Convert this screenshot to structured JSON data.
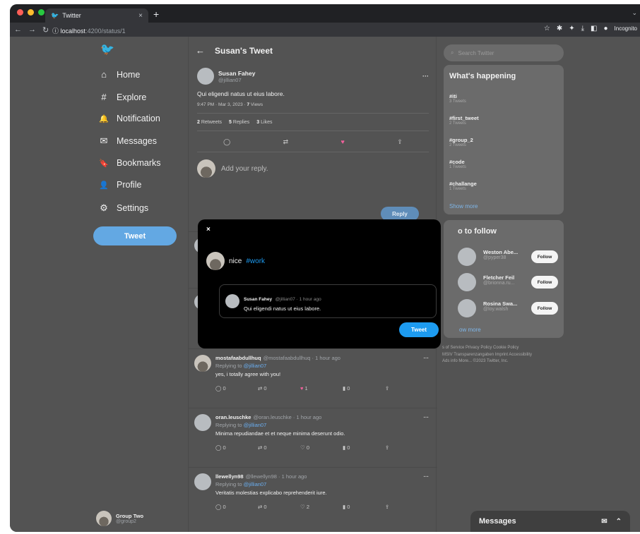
{
  "browser": {
    "tab_title": "Twitter",
    "tab_close": "×",
    "new_tab": "+",
    "url_host": "localhost",
    "url_path": ":4200/status/1",
    "incognito_label": "Incognito"
  },
  "sidebar": {
    "items": [
      {
        "label": "Home",
        "icon": "home-icon",
        "glyph": "⌂"
      },
      {
        "label": "Explore",
        "icon": "hashtag-icon",
        "glyph": "#"
      },
      {
        "label": "Notification",
        "icon": "bell-icon",
        "glyph": "🔔"
      },
      {
        "label": "Messages",
        "icon": "envelope-icon",
        "glyph": "✉"
      },
      {
        "label": "Bookmarks",
        "icon": "bookmark-icon",
        "glyph": "🔖"
      },
      {
        "label": "Profile",
        "icon": "person-icon",
        "glyph": "👤"
      },
      {
        "label": "Settings",
        "icon": "gear-icon",
        "glyph": "⚙"
      }
    ],
    "tweet_button": "Tweet",
    "account": {
      "name": "Group Two",
      "handle": "@group2"
    }
  },
  "header": {
    "title": "Susan's Tweet"
  },
  "main_tweet": {
    "name": "Susan Fahey",
    "handle": "@jillian07",
    "text": "Qui eligendi natus ut eius labore.",
    "time": "9:47 PM",
    "date": "Mar 3, 2023",
    "views_count": "7",
    "views_label": "Views",
    "retweets_count": "2",
    "retweets_label": "Retweets",
    "replies_count": "5",
    "replies_label": "Replies",
    "likes_count": "3",
    "likes_label": "Likes"
  },
  "reply_box": {
    "placeholder": "Add your reply.",
    "button": "Reply"
  },
  "replies": [
    {
      "name": "mostafaabdullhuq",
      "handle": "@mostafaabdullhuq",
      "time": "1 hour ago",
      "replying": "Replying to",
      "to": "@jillian07",
      "text": "yes, i totally agree with you!",
      "comments": "0",
      "retweets": "0",
      "likes": "1",
      "views": "0",
      "liked": true
    },
    {
      "name": "oran.leuschke",
      "handle": "@oran.leuschke",
      "time": "1 hour ago",
      "replying": "Replying to",
      "to": "@jillian07",
      "text": "Minima repudiandae et et neque minima deserunt odio.",
      "comments": "0",
      "retweets": "0",
      "likes": "0",
      "views": "0",
      "liked": false
    },
    {
      "name": "llewellyn98",
      "handle": "@llewellyn98",
      "time": "1 hour ago",
      "replying": "Replying to",
      "to": "@jillian07",
      "text": "Veritatis molestias explicabo reprehenderit iure.",
      "comments": "0",
      "retweets": "0",
      "likes": "2",
      "views": "0",
      "liked": false
    }
  ],
  "search": {
    "placeholder": "Search Twitter"
  },
  "trends": {
    "title": "What's happening",
    "items": [
      {
        "tag": "#iti",
        "count": "3 Tweets"
      },
      {
        "tag": "#first_tweet",
        "count": "2 Tweets"
      },
      {
        "tag": "#group_2",
        "count": "2 Tweets"
      },
      {
        "tag": "#code",
        "count": "1 Tweets"
      },
      {
        "tag": "#challange",
        "count": "1 Tweets"
      }
    ],
    "show_more": "Show more"
  },
  "who_to_follow": {
    "title_visible": "o to follow",
    "items": [
      {
        "name": "Weston Abe...",
        "handle": "@pyper38",
        "button": "Follow"
      },
      {
        "name": "Fletcher Feil",
        "handle": "@brionna.ru...",
        "button": "Follow"
      },
      {
        "name": "Rosina Swa...",
        "handle": "@loy.walsh",
        "button": "Follow"
      }
    ],
    "show_more_visible": "ow more"
  },
  "footer": {
    "line1": "s of Service  Privacy Policy  Cookie Policy",
    "line2": "MSIV Transparenzangaben  Imprint  Accessibility",
    "line3": "Ads info  More...  ©2023 Twitter, Inc."
  },
  "messages_bar": {
    "label": "Messages"
  },
  "modal": {
    "close": "×",
    "draft_text": "nice",
    "draft_hashtag": "#work",
    "quote_name": "Susan Fahey",
    "quote_handle": "@jillian07",
    "quote_time": "1 hour ago",
    "quote_text": "Qui eligendi natus ut eius labore.",
    "tweet_button": "Tweet"
  },
  "colors": {
    "accent": "#1d9bf0",
    "like": "#f0619b",
    "background": "#535353",
    "modal": "#000000"
  }
}
